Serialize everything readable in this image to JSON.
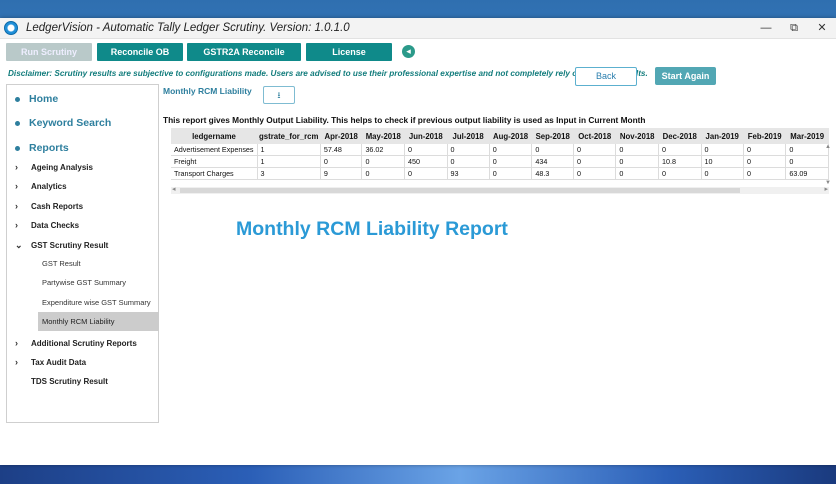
{
  "window": {
    "title": "LedgerVision - Automatic Tally Ledger Scrutiny.  Version: 1.0.1.0",
    "controls": {
      "minimize": "—",
      "restore": "⧉",
      "close": "✕"
    }
  },
  "toolbar": {
    "run_scrutiny": "Run Scrutiny",
    "reconcile_ob": "Reconcile OB",
    "gstr2a_reconcile": "GSTR2A Reconcile",
    "license": "License",
    "nav_icon": "◂"
  },
  "disclaimer": "Disclaimer: Scrutiny results are subjective to configurations made. Users are advised to use their professional expertise and not completely rely on scrutiny results.",
  "actions": {
    "back": "Back",
    "start_again": "Start Again"
  },
  "sidebar": {
    "home": "Home",
    "keyword_search": "Keyword Search",
    "reports": "Reports",
    "items": [
      {
        "label": "Ageing Analysis",
        "arrow": "›"
      },
      {
        "label": "Analytics",
        "arrow": "›"
      },
      {
        "label": "Cash Reports",
        "arrow": "›"
      },
      {
        "label": "Data Checks",
        "arrow": "›"
      },
      {
        "label": "GST Scrutiny Result",
        "arrow": "⌄"
      }
    ],
    "sub_items": [
      {
        "label": "GST Result"
      },
      {
        "label": "Partywise GST Summary"
      },
      {
        "label": "Expenditure wise GST Summary"
      },
      {
        "label": "Monthly RCM Liability"
      }
    ],
    "more_items": [
      {
        "label": "Additional Scrutiny Reports",
        "arrow": "›"
      },
      {
        "label": "Tax Audit Data",
        "arrow": "›"
      },
      {
        "label": "TDS Scrutiny Result",
        "arrow": ""
      }
    ]
  },
  "report": {
    "title": "Monthly RCM Liability",
    "download_icon": "⭳",
    "description": "This report gives Monthly Output Liability. This helps to check if previous output liability is used as Input in Current Month",
    "big_title": "Monthly RCM Liability Report"
  },
  "table": {
    "columns": [
      "ledgername",
      "gstrate_for_rcm",
      "Apr-2018",
      "May-2018",
      "Jun-2018",
      "Jul-2018",
      "Aug-2018",
      "Sep-2018",
      "Oct-2018",
      "Nov-2018",
      "Dec-2018",
      "Jan-2019",
      "Feb-2019",
      "Mar-2019"
    ],
    "rows": [
      [
        "Advertisement Expenses",
        "1",
        "57.48",
        "36.02",
        "0",
        "0",
        "0",
        "0",
        "0",
        "0",
        "0",
        "0",
        "0",
        "0"
      ],
      [
        "Freight",
        "1",
        "0",
        "0",
        "450",
        "0",
        "0",
        "434",
        "0",
        "0",
        "10.8",
        "10",
        "0",
        "0"
      ],
      [
        "Transport Charges",
        "3",
        "9",
        "0",
        "0",
        "93",
        "0",
        "48.3",
        "0",
        "0",
        "0",
        "0",
        "0",
        "63.09"
      ]
    ]
  },
  "colors": {
    "teal": "#0f8a8a",
    "accent": "#2e7f9e",
    "title_blue": "#2b9ad6"
  }
}
